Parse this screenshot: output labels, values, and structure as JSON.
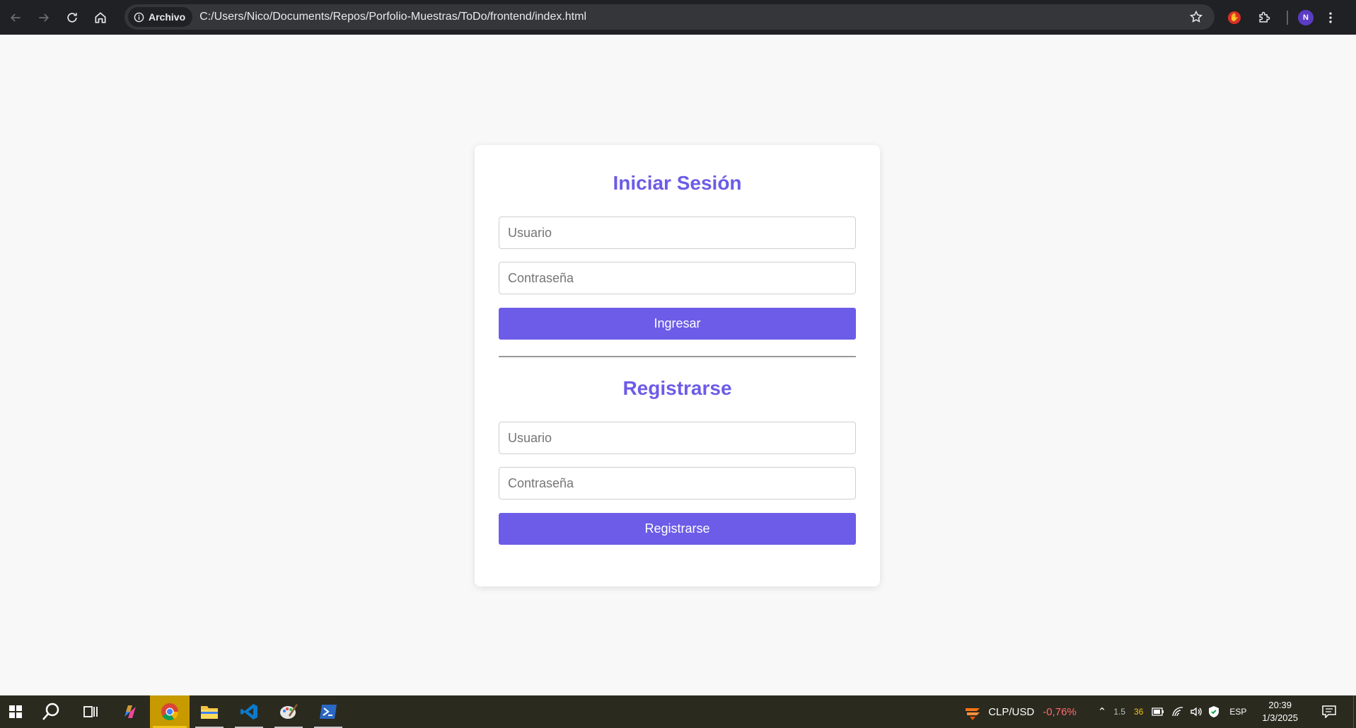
{
  "browser": {
    "site_chip_label": "Archivo",
    "url": "C:/Users/Nico/Documents/Repos/Porfolio-Muestras/ToDo/frontend/index.html",
    "profile_initial": "N"
  },
  "login": {
    "title": "Iniciar Sesión",
    "username_placeholder": "Usuario",
    "password_placeholder": "Contraseña",
    "submit_label": "Ingresar"
  },
  "register": {
    "title": "Registrarse",
    "username_placeholder": "Usuario",
    "password_placeholder": "Contraseña",
    "submit_label": "Registrarse"
  },
  "taskbar": {
    "apps": [
      "windows-start",
      "search",
      "task-view",
      "copilot",
      "chrome",
      "file-explorer",
      "vscode",
      "paint",
      "powershell"
    ],
    "widget_label": "CLP/USD",
    "widget_value": "-0,76%",
    "tray_val1": "1.5",
    "tray_val2": "36",
    "language": "ESP",
    "time": "20:39",
    "date": "1/3/2025"
  },
  "colors": {
    "accent": "#6c5ce7",
    "negative": "#ff6b6b"
  }
}
